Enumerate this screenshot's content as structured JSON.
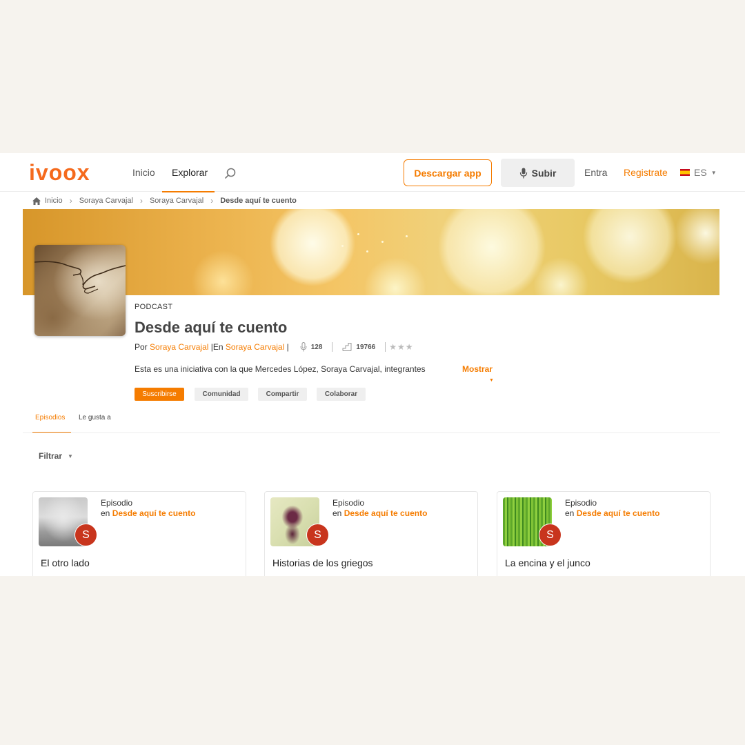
{
  "header": {
    "logo": "ivoox",
    "nav": {
      "inicio": "Inicio",
      "explorar": "Explorar"
    },
    "download_button": "Descargar app",
    "upload_button": "Subir",
    "login": "Entra",
    "register": "Registrate",
    "language": "ES"
  },
  "breadcrumb": {
    "home": "Inicio",
    "items": [
      "Soraya Carvajal",
      "Soraya Carvajal"
    ],
    "current": "Desde aquí te cuento"
  },
  "podcast": {
    "label": "PODCAST",
    "title": "Desde aquí te cuento",
    "by_prefix": "Por",
    "author": "Soraya Carvajal",
    "in_prefix": "|En",
    "channel": "Soraya Carvajal",
    "separator": "|",
    "episodes_count": "128",
    "followers_count": "19766",
    "rating_stars": "★★★",
    "description": "Esta es una iniciativa con la que Mercedes López, Soraya Carvajal, integrantes",
    "show_more": "Mostrar"
  },
  "actions": {
    "subscribe": "Suscribirse",
    "community": "Comunidad",
    "share": "Compartir",
    "collaborate": "Colaborar"
  },
  "tabs": {
    "episodes": "Episodios",
    "likes": "Le gusta a"
  },
  "filter": {
    "label": "Filtrar"
  },
  "episodes": [
    {
      "type": "Episodio",
      "in": "en",
      "podcast": "Desde aquí te cuento",
      "avatar": "S",
      "title": "El otro lado"
    },
    {
      "type": "Episodio",
      "in": "en",
      "podcast": "Desde aquí te cuento",
      "avatar": "S",
      "title": "Historias de los griegos"
    },
    {
      "type": "Episodio",
      "in": "en",
      "podcast": "Desde aquí te cuento",
      "avatar": "S",
      "title": "La encina y el junco"
    }
  ],
  "colors": {
    "accent": "#f57c00",
    "logo": "#f56a1d",
    "avatar": "#c8351d",
    "page_bg": "#f6f3ee"
  },
  "icons": [
    "search-icon",
    "microphone-icon",
    "home-icon",
    "chevron-right-icon",
    "stats-icon",
    "star-icon",
    "chevron-down-icon",
    "spain-flag-icon"
  ]
}
